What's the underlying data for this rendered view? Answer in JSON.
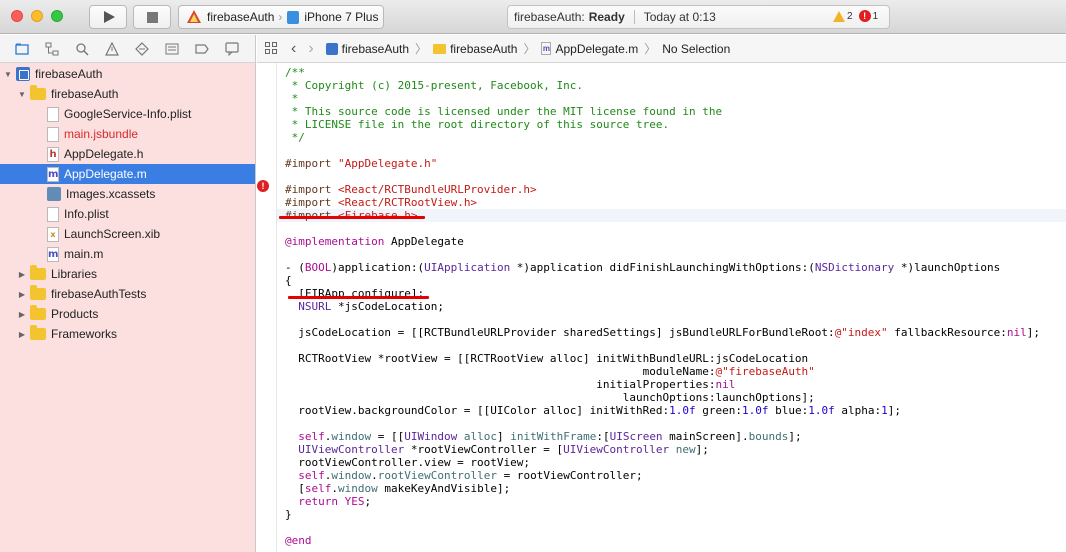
{
  "titlebar": {
    "scheme_project": "firebaseAuth",
    "scheme_device": "iPhone 7 Plus",
    "status_project": "firebaseAuth:",
    "status_state": "Ready",
    "status_time": "Today at 0:13",
    "warning_count": "2",
    "error_count": "1"
  },
  "navigator": {
    "toolbar_icons": [
      "folder-icon",
      "hierarchy-icon",
      "search-icon",
      "warning-icon",
      "test-icon",
      "debug-icon",
      "breakpoint-icon",
      "report-icon"
    ],
    "rows": [
      {
        "label": "firebaseAuth",
        "kind": "project",
        "disclosure": "▼"
      },
      {
        "label": "firebaseAuth",
        "kind": "folder",
        "disclosure": "▼"
      },
      {
        "label": "GoogleService-Info.plist",
        "kind": "file"
      },
      {
        "label": "main.jsbundle",
        "kind": "file",
        "missing": true
      },
      {
        "label": "AppDelegate.h",
        "kind": "header",
        "glyph": "h"
      },
      {
        "label": "AppDelegate.m",
        "kind": "impl",
        "glyph": "m",
        "selected": true
      },
      {
        "label": "Images.xcassets",
        "kind": "assets"
      },
      {
        "label": "Info.plist",
        "kind": "file"
      },
      {
        "label": "LaunchScreen.xib",
        "kind": "xib",
        "glyph": "x"
      },
      {
        "label": "main.m",
        "kind": "impl",
        "glyph": "m"
      },
      {
        "label": "Libraries",
        "kind": "folder",
        "disclosure": "▶"
      },
      {
        "label": "firebaseAuthTests",
        "kind": "folder",
        "disclosure": "▶"
      },
      {
        "label": "Products",
        "kind": "folder",
        "disclosure": "▶"
      },
      {
        "label": "Frameworks",
        "kind": "folder",
        "disclosure": "▶"
      }
    ]
  },
  "jumpbar": {
    "crumb_project": "firebaseAuth",
    "crumb_folder": "firebaseAuth",
    "crumb_file": "AppDelegate.m",
    "crumb_symbol": "No Selection",
    "file_glyph": "m"
  },
  "editor": {
    "error_glyph": "!",
    "lines": [
      [
        [
          "c-comment",
          "/**"
        ]
      ],
      [
        [
          "c-comment",
          " * Copyright (c) 2015-present, Facebook, Inc."
        ]
      ],
      [
        [
          "c-comment",
          " *"
        ]
      ],
      [
        [
          "c-comment",
          " * This source code is licensed under the MIT license found in the"
        ]
      ],
      [
        [
          "c-comment",
          " * LICENSE file in the root directory of this source tree."
        ]
      ],
      [
        [
          "c-comment",
          " */"
        ]
      ],
      [],
      [
        [
          "c-dir",
          "#import "
        ],
        [
          "c-str",
          "\"AppDelegate.h\""
        ]
      ],
      [],
      [
        [
          "c-dir",
          "#import "
        ],
        [
          "c-str",
          "<React/RCTBundleURLProvider.h>"
        ]
      ],
      [
        [
          "c-dir",
          "#import "
        ],
        [
          "c-str",
          "<React/RCTRootView.h>"
        ]
      ],
      [
        [
          "c-dir",
          "#import "
        ],
        [
          "c-str",
          "<Firebase.h>"
        ]
      ],
      [],
      [
        [
          "c-kw",
          "@implementation"
        ],
        [
          "c-plain",
          " AppDelegate"
        ]
      ],
      [],
      [
        [
          "c-plain",
          "- ("
        ],
        [
          "c-kw",
          "BOOL"
        ],
        [
          "c-plain",
          ")application:("
        ],
        [
          "c-cls",
          "UIApplication"
        ],
        [
          "c-plain",
          " *)application didFinishLaunchingWithOptions:("
        ],
        [
          "c-cls",
          "NSDictionary"
        ],
        [
          "c-plain",
          " *)launchOptions"
        ]
      ],
      [
        [
          "c-plain",
          "{"
        ]
      ],
      [
        [
          "c-plain",
          "  [FIRApp configure];"
        ]
      ],
      [
        [
          "c-plain",
          "  "
        ],
        [
          "c-cls",
          "NSURL"
        ],
        [
          "c-plain",
          " *jsCodeLocation;"
        ]
      ],
      [],
      [
        [
          "c-plain",
          "  jsCodeLocation = [[RCTBundleURLProvider sharedSettings] jsBundleURLForBundleRoot:"
        ],
        [
          "c-str",
          "@\"index\""
        ],
        [
          "c-plain",
          " fallbackResource:"
        ],
        [
          "c-kw",
          "nil"
        ],
        [
          "c-plain",
          "];"
        ]
      ],
      [],
      [
        [
          "c-plain",
          "  RCTRootView *rootView = [[RCTRootView alloc] initWithBundleURL:jsCodeLocation"
        ]
      ],
      [
        [
          "c-plain",
          "                                                      moduleName:"
        ],
        [
          "c-str",
          "@\"firebaseAuth\""
        ]
      ],
      [
        [
          "c-plain",
          "                                               initialProperties:"
        ],
        [
          "c-kw",
          "nil"
        ]
      ],
      [
        [
          "c-plain",
          "                                                   launchOptions:launchOptions];"
        ]
      ],
      [
        [
          "c-plain",
          "  rootView.backgroundColor = [[UIColor alloc] initWithRed:"
        ],
        [
          "c-num",
          "1.0f"
        ],
        [
          "c-plain",
          " green:"
        ],
        [
          "c-num",
          "1.0f"
        ],
        [
          "c-plain",
          " blue:"
        ],
        [
          "c-num",
          "1.0f"
        ],
        [
          "c-plain",
          " alpha:"
        ],
        [
          "c-num",
          "1"
        ],
        [
          "c-plain",
          "];"
        ]
      ],
      [],
      [
        [
          "c-plain",
          "  "
        ],
        [
          "c-kw",
          "self"
        ],
        [
          "c-plain",
          "."
        ],
        [
          "c-type",
          "window"
        ],
        [
          "c-plain",
          " = [["
        ],
        [
          "c-cls",
          "UIWindow"
        ],
        [
          "c-plain",
          " "
        ],
        [
          "c-type",
          "alloc"
        ],
        [
          "c-plain",
          "] "
        ],
        [
          "c-type",
          "initWithFrame"
        ],
        [
          "c-plain",
          ":["
        ],
        [
          "c-cls",
          "UIScreen"
        ],
        [
          "c-plain",
          " mainScreen]."
        ],
        [
          "c-type",
          "bounds"
        ],
        [
          "c-plain",
          "];"
        ]
      ],
      [
        [
          "c-plain",
          "  "
        ],
        [
          "c-cls",
          "UIViewController"
        ],
        [
          "c-plain",
          " *rootViewController = ["
        ],
        [
          "c-cls",
          "UIViewController"
        ],
        [
          "c-plain",
          " "
        ],
        [
          "c-type",
          "new"
        ],
        [
          "c-plain",
          "];"
        ]
      ],
      [
        [
          "c-plain",
          "  rootViewController.view = rootView;"
        ]
      ],
      [
        [
          "c-plain",
          "  "
        ],
        [
          "c-kw",
          "self"
        ],
        [
          "c-plain",
          "."
        ],
        [
          "c-type",
          "window"
        ],
        [
          "c-plain",
          "."
        ],
        [
          "c-type",
          "rootViewController"
        ],
        [
          "c-plain",
          " = rootViewController;"
        ]
      ],
      [
        [
          "c-plain",
          "  ["
        ],
        [
          "c-kw",
          "self"
        ],
        [
          "c-plain",
          "."
        ],
        [
          "c-type",
          "window"
        ],
        [
          "c-plain",
          " makeKeyAndVisible];"
        ]
      ],
      [
        [
          "c-plain",
          "  "
        ],
        [
          "c-kw",
          "return"
        ],
        [
          "c-plain",
          " "
        ],
        [
          "c-kw",
          "YES"
        ],
        [
          "c-plain",
          ";"
        ]
      ],
      [
        [
          "c-plain",
          "}"
        ]
      ],
      [],
      [
        [
          "c-kw",
          "@end"
        ]
      ]
    ]
  }
}
